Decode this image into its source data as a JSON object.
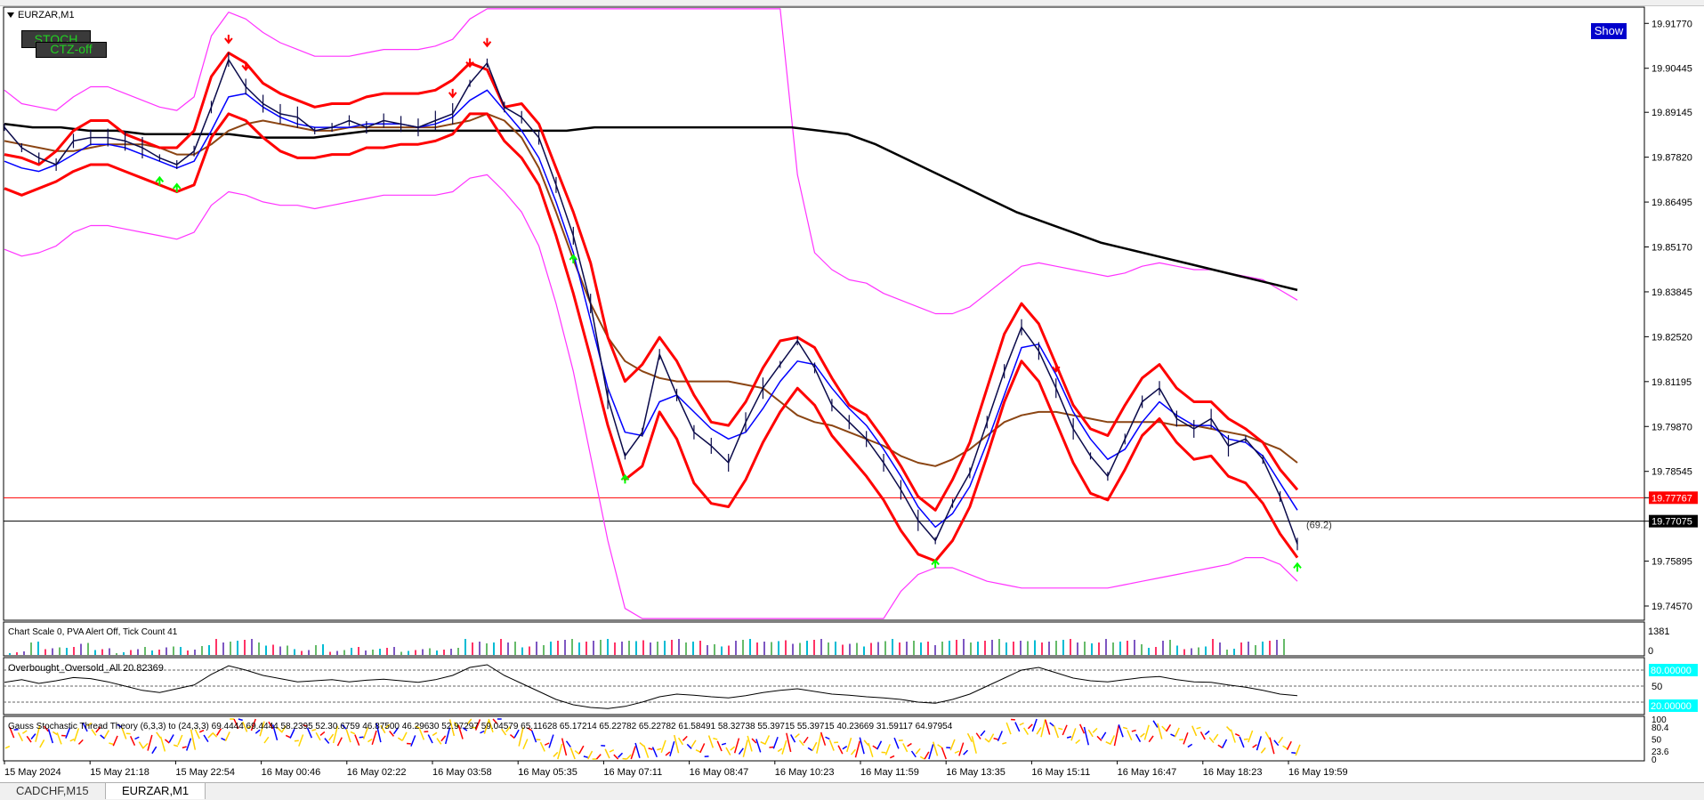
{
  "window": {
    "symbol_title": "EURZAR,M1",
    "stoch_button": "STOCH",
    "ctz_button": "CTZ-off",
    "show_button": "Show"
  },
  "colors": {
    "price": "#0a0a4a",
    "red_env": "#ff0000",
    "magenta": "#ff33ff",
    "black_ma": "#000000",
    "brown_ma": "#8b4513",
    "blue_ma": "#0000ff",
    "teal_ma": "#008080",
    "bid_line": "#ff0000",
    "ask_line": "#000000",
    "up_arrow": "#00ff00",
    "down_arrow": "#ff0000",
    "show_bg": "#0000cc",
    "oversold_bg": "#00ffff"
  },
  "chart_data": {
    "type": "line",
    "x_ticks": [
      "15 May 2024",
      "15 May 21:18",
      "15 May 22:54",
      "16 May 00:46",
      "16 May 02:22",
      "16 May 03:58",
      "16 May 05:35",
      "16 May 07:11",
      "16 May 08:47",
      "16 May 10:23",
      "16 May 11:59",
      "16 May 13:35",
      "16 May 15:11",
      "16 May 16:47",
      "16 May 18:23",
      "16 May 19:59"
    ],
    "y_ticks": [
      "19.91770",
      "19.90445",
      "19.89145",
      "19.87820",
      "19.86495",
      "19.85170",
      "19.83845",
      "19.82520",
      "19.81195",
      "19.79870",
      "19.78545",
      "19.77767",
      "19.77075",
      "19.75895",
      "19.74570"
    ],
    "ylim": [
      19.7415,
      19.9225
    ],
    "bid_price": "19.77767",
    "ask_price": "19.77075",
    "bid_value": 19.77767,
    "ask_value": 19.77075,
    "price_annotation": "(69.2)",
    "price": [
      19.887,
      19.881,
      19.878,
      19.876,
      19.883,
      19.884,
      19.884,
      19.883,
      19.881,
      19.878,
      19.876,
      19.88,
      19.893,
      19.907,
      19.899,
      19.894,
      19.891,
      19.89,
      19.886,
      19.887,
      19.889,
      19.887,
      19.889,
      19.888,
      19.887,
      19.889,
      19.891,
      19.9,
      19.906,
      19.893,
      19.89,
      19.884,
      19.87,
      19.855,
      19.835,
      19.807,
      19.79,
      19.797,
      19.82,
      19.808,
      19.797,
      19.793,
      19.788,
      19.8,
      19.81,
      19.817,
      19.824,
      19.816,
      19.805,
      19.8,
      19.795,
      19.788,
      19.78,
      19.771,
      19.765,
      19.776,
      19.785,
      19.8,
      19.815,
      19.828,
      19.821,
      19.81,
      19.798,
      19.79,
      19.784,
      19.795,
      19.806,
      19.81,
      19.801,
      19.798,
      19.801,
      19.793,
      19.795,
      19.789,
      19.778,
      19.764
    ],
    "red_upper": [
      19.879,
      19.878,
      19.876,
      19.88,
      19.886,
      19.889,
      19.889,
      19.885,
      19.883,
      19.881,
      19.881,
      19.886,
      19.902,
      19.909,
      19.906,
      19.9,
      19.897,
      19.895,
      19.893,
      19.894,
      19.894,
      19.896,
      19.897,
      19.897,
      19.897,
      19.898,
      19.901,
      19.906,
      19.904,
      19.893,
      19.894,
      19.888,
      19.875,
      19.862,
      19.847,
      19.825,
      19.812,
      19.817,
      19.825,
      19.818,
      19.808,
      19.8,
      19.799,
      19.806,
      19.816,
      19.824,
      19.825,
      19.822,
      19.813,
      19.805,
      19.802,
      19.795,
      19.787,
      19.778,
      19.774,
      19.783,
      19.794,
      19.81,
      19.826,
      19.835,
      19.829,
      19.817,
      19.805,
      19.798,
      19.796,
      19.805,
      19.813,
      19.817,
      19.81,
      19.806,
      19.806,
      19.801,
      19.798,
      19.794,
      19.786,
      19.78
    ],
    "red_lower": [
      19.869,
      19.867,
      19.869,
      19.871,
      19.874,
      19.876,
      19.876,
      19.874,
      19.872,
      19.87,
      19.868,
      19.87,
      19.884,
      19.891,
      19.889,
      19.884,
      19.88,
      19.878,
      19.878,
      19.879,
      19.879,
      19.881,
      19.881,
      19.882,
      19.882,
      19.883,
      19.885,
      19.891,
      19.891,
      19.883,
      19.878,
      19.87,
      19.855,
      19.838,
      19.819,
      19.799,
      19.783,
      19.787,
      19.803,
      19.795,
      19.782,
      19.776,
      19.775,
      19.783,
      19.794,
      19.803,
      19.81,
      19.805,
      19.796,
      19.79,
      19.784,
      19.777,
      19.768,
      19.761,
      19.759,
      19.765,
      19.775,
      19.79,
      19.806,
      19.818,
      19.812,
      19.8,
      19.788,
      19.779,
      19.777,
      19.786,
      19.796,
      19.801,
      19.794,
      19.789,
      19.79,
      19.784,
      19.782,
      19.776,
      19.767,
      19.76
    ],
    "magenta_upper": [
      19.898,
      19.894,
      19.893,
      19.892,
      19.896,
      19.899,
      19.899,
      19.897,
      19.895,
      19.893,
      19.892,
      19.896,
      19.914,
      19.921,
      19.919,
      19.915,
      19.912,
      19.91,
      19.908,
      19.908,
      19.908,
      19.909,
      19.91,
      19.91,
      19.91,
      19.911,
      19.913,
      19.919,
      19.922,
      19.922,
      19.922,
      19.922,
      19.922,
      19.922,
      19.922,
      19.922,
      19.922,
      19.922,
      19.922,
      19.922,
      19.922,
      19.922,
      19.922,
      19.922,
      19.922,
      19.922,
      19.873,
      19.85,
      19.845,
      19.842,
      19.841,
      19.838,
      19.836,
      19.834,
      19.832,
      19.832,
      19.834,
      19.838,
      19.842,
      19.846,
      19.847,
      19.846,
      19.845,
      19.844,
      19.843,
      19.844,
      19.846,
      19.847,
      19.846,
      19.845,
      19.845,
      19.844,
      19.843,
      19.842,
      19.839,
      19.836
    ],
    "magenta_lower": [
      19.851,
      19.849,
      19.85,
      19.852,
      19.856,
      19.858,
      19.858,
      19.857,
      19.856,
      19.855,
      19.854,
      19.856,
      19.864,
      19.868,
      19.867,
      19.865,
      19.864,
      19.864,
      19.863,
      19.864,
      19.865,
      19.866,
      19.867,
      19.867,
      19.867,
      19.867,
      19.868,
      19.872,
      19.873,
      19.868,
      19.862,
      19.852,
      19.835,
      19.815,
      19.79,
      19.765,
      19.745,
      19.742,
      19.742,
      19.742,
      19.742,
      19.742,
      19.742,
      19.742,
      19.742,
      19.742,
      19.742,
      19.742,
      19.742,
      19.742,
      19.742,
      19.742,
      19.75,
      19.755,
      19.757,
      19.757,
      19.755,
      19.753,
      19.752,
      19.751,
      19.751,
      19.751,
      19.751,
      19.751,
      19.751,
      19.752,
      19.753,
      19.754,
      19.755,
      19.756,
      19.757,
      19.758,
      19.76,
      19.76,
      19.758,
      19.753
    ],
    "black_ma": [
      19.888,
      19.887,
      19.887,
      19.886,
      19.886,
      19.885,
      19.885,
      19.885,
      19.885,
      19.884,
      19.884,
      19.884,
      19.885,
      19.886,
      19.886,
      19.886,
      19.886,
      19.886,
      19.886,
      19.886,
      19.886,
      19.887,
      19.887,
      19.887,
      19.887,
      19.887,
      19.887,
      19.887,
      19.887,
      19.886,
      19.885,
      19.882,
      19.878,
      19.874,
      19.87,
      19.866,
      19.862,
      19.859,
      19.856,
      19.853,
      19.851,
      19.849,
      19.847,
      19.845,
      19.843,
      19.841,
      19.839
    ],
    "brown_ma": [
      19.883,
      19.882,
      19.881,
      19.88,
      19.88,
      19.881,
      19.882,
      19.882,
      19.882,
      19.881,
      19.879,
      19.879,
      19.882,
      19.886,
      19.888,
      19.889,
      19.888,
      19.887,
      19.886,
      19.886,
      19.887,
      19.887,
      19.887,
      19.887,
      19.887,
      19.887,
      19.888,
      19.889,
      19.891,
      19.889,
      19.884,
      19.875,
      19.862,
      19.848,
      19.835,
      19.825,
      19.818,
      19.815,
      19.813,
      19.812,
      19.812,
      19.812,
      19.812,
      19.811,
      19.81,
      19.806,
      19.802,
      19.8,
      19.799,
      19.797,
      19.795,
      19.793,
      19.79,
      19.788,
      19.787,
      19.789,
      19.792,
      19.796,
      19.8,
      19.802,
      19.803,
      19.803,
      19.802,
      19.801,
      19.8,
      19.8,
      19.8,
      19.8,
      19.799,
      19.799,
      19.798,
      19.797,
      19.796,
      19.794,
      19.792,
      19.788
    ],
    "blue_ma": [
      19.877,
      19.875,
      19.874,
      19.876,
      19.879,
      19.882,
      19.882,
      19.881,
      19.879,
      19.877,
      19.875,
      19.877,
      19.886,
      19.896,
      19.897,
      19.893,
      19.89,
      19.888,
      19.887,
      19.887,
      19.887,
      19.888,
      19.888,
      19.888,
      19.887,
      19.888,
      19.89,
      19.895,
      19.898,
      19.892,
      19.886,
      19.878,
      19.865,
      19.85,
      19.83,
      19.81,
      19.797,
      19.796,
      19.806,
      19.808,
      19.803,
      19.798,
      19.795,
      19.797,
      19.804,
      19.812,
      19.818,
      19.817,
      19.81,
      19.804,
      19.799,
      19.792,
      19.784,
      19.775,
      19.769,
      19.773,
      19.781,
      19.794,
      19.808,
      19.822,
      19.823,
      19.814,
      19.803,
      19.795,
      19.789,
      19.792,
      19.8,
      19.806,
      19.802,
      19.799,
      19.799,
      19.795,
      19.794,
      19.79,
      19.782,
      19.774
    ],
    "stoch": [
      57,
      62,
      55,
      60,
      66,
      64,
      58,
      50,
      42,
      38,
      45,
      52,
      72,
      88,
      80,
      70,
      64,
      58,
      60,
      62,
      58,
      61,
      63,
      60,
      57,
      62,
      70,
      85,
      90,
      70,
      55,
      40,
      25,
      15,
      10,
      8,
      12,
      20,
      30,
      35,
      33,
      30,
      28,
      32,
      38,
      42,
      45,
      40,
      35,
      33,
      30,
      28,
      25,
      20,
      18,
      25,
      35,
      50,
      65,
      80,
      85,
      75,
      65,
      60,
      58,
      62,
      66,
      68,
      62,
      58,
      57,
      52,
      48,
      42,
      35,
      32
    ]
  },
  "volume_panel": {
    "label": "Chart Scale  0,   PVA Alert Off,   Tick Count  41",
    "max": "1381",
    "min": "0"
  },
  "osc_panel": {
    "label": "Overbought_Oversold_All 20.82369",
    "level_high": "80.00000",
    "level_mid": "50",
    "level_low": "20.00000"
  },
  "stoch_panel": {
    "label": "Gauss Stochastic Thread Theory (6,3,3) to (24,3,3) 69.4444 69.4444 58.2395 52.30.6759 46.87500 46.29630 52.97297 59.04579 65.11628 65.17214 65.22782 65.22782 61.58491 58.32738 55.39715 55.39715 40.23669 31.59117 64.97954",
    "tick_top": "100",
    "tick_80": "80.4",
    "tick_50": "50",
    "tick_20": "23.6",
    "tick_0": "0"
  },
  "tabs": [
    {
      "label": "CADCHF,M15",
      "active": false
    },
    {
      "label": "EURZAR,M1",
      "active": true
    }
  ]
}
